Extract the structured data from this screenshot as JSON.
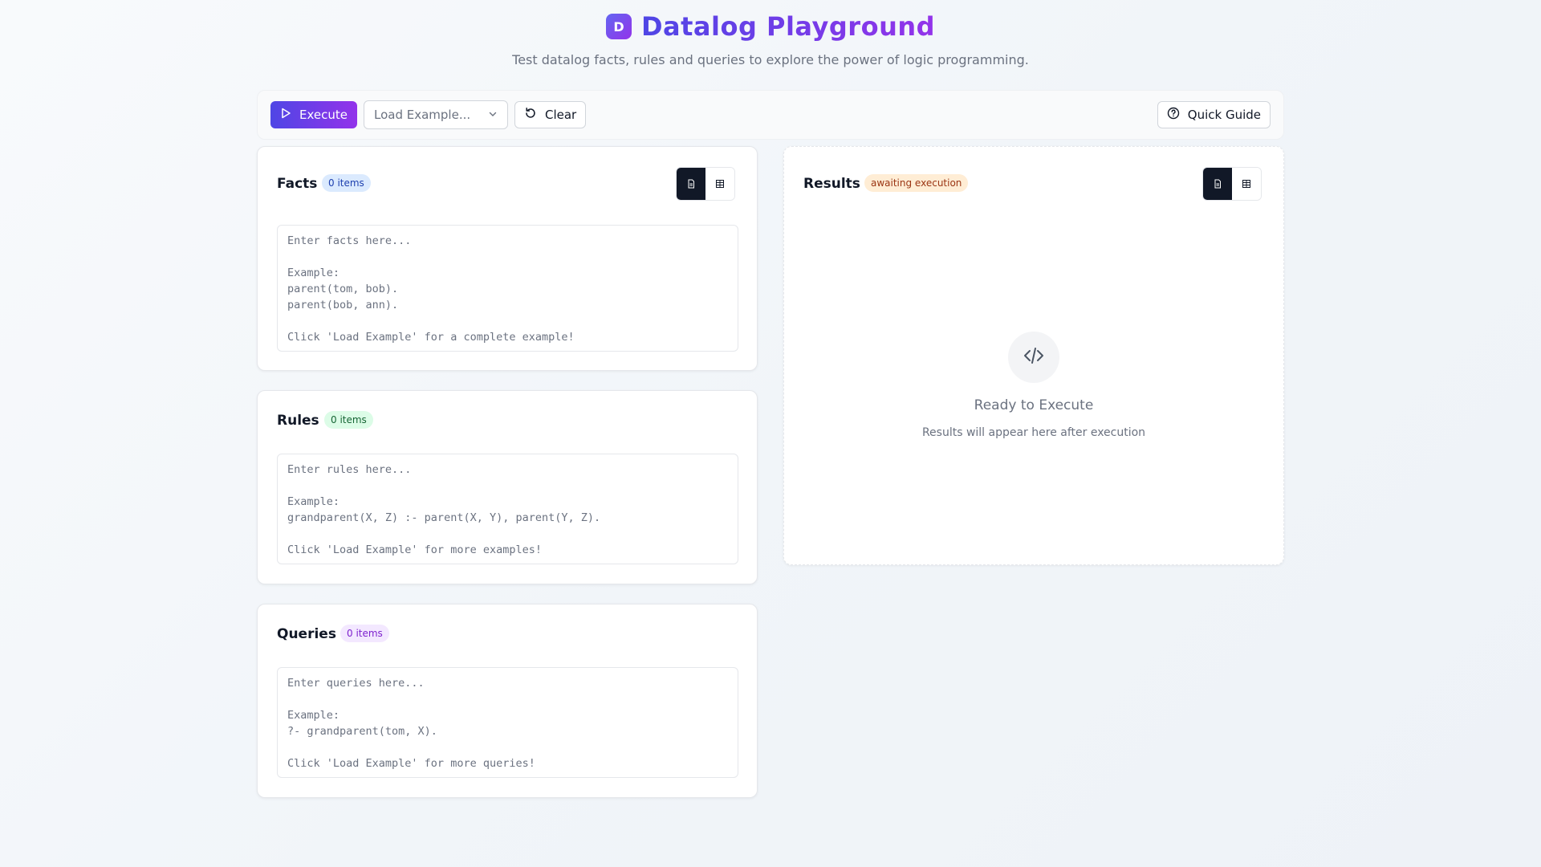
{
  "header": {
    "logo_letter": "D",
    "title": "Datalog Playground",
    "subtitle": "Test datalog facts, rules and queries to explore the power of logic programming."
  },
  "toolbar": {
    "execute_label": "Execute",
    "example_select": {
      "placeholder": "Load Example..."
    },
    "clear_label": "Clear",
    "quick_guide_label": "Quick Guide"
  },
  "facts": {
    "title": "Facts",
    "count_badge": "0 items",
    "placeholder": "Enter facts here...\n\nExample:\nparent(tom, bob).\nparent(bob, ann).\n\nClick 'Load Example' for a complete example!"
  },
  "rules": {
    "title": "Rules",
    "count_badge": "0 items",
    "placeholder": "Enter rules here...\n\nExample:\ngrandparent(X, Z) :- parent(X, Y), parent(Y, Z).\n\nClick 'Load Example' for more examples!"
  },
  "queries": {
    "title": "Queries",
    "count_badge": "0 items",
    "placeholder": "Enter queries here...\n\nExample:\n?- grandparent(tom, X).\n\nClick 'Load Example' for more queries!"
  },
  "results": {
    "title": "Results",
    "status_badge": "awaiting execution",
    "empty_title": "Ready to Execute",
    "empty_subtitle": "Results will appear here after execution"
  },
  "icons": {
    "logo": "letter-logo",
    "execute": "play-icon",
    "select": "chevron-down-icon",
    "clear": "rotate-ccw-icon",
    "guide": "help-circle-icon",
    "text_view": "file-text-icon",
    "table_view": "table-icon",
    "empty_state": "code-icon"
  },
  "colors": {
    "accent_start": "#4f46e5",
    "accent_end": "#9333ea",
    "dark": "#111827",
    "muted_text": "#6b7280"
  }
}
